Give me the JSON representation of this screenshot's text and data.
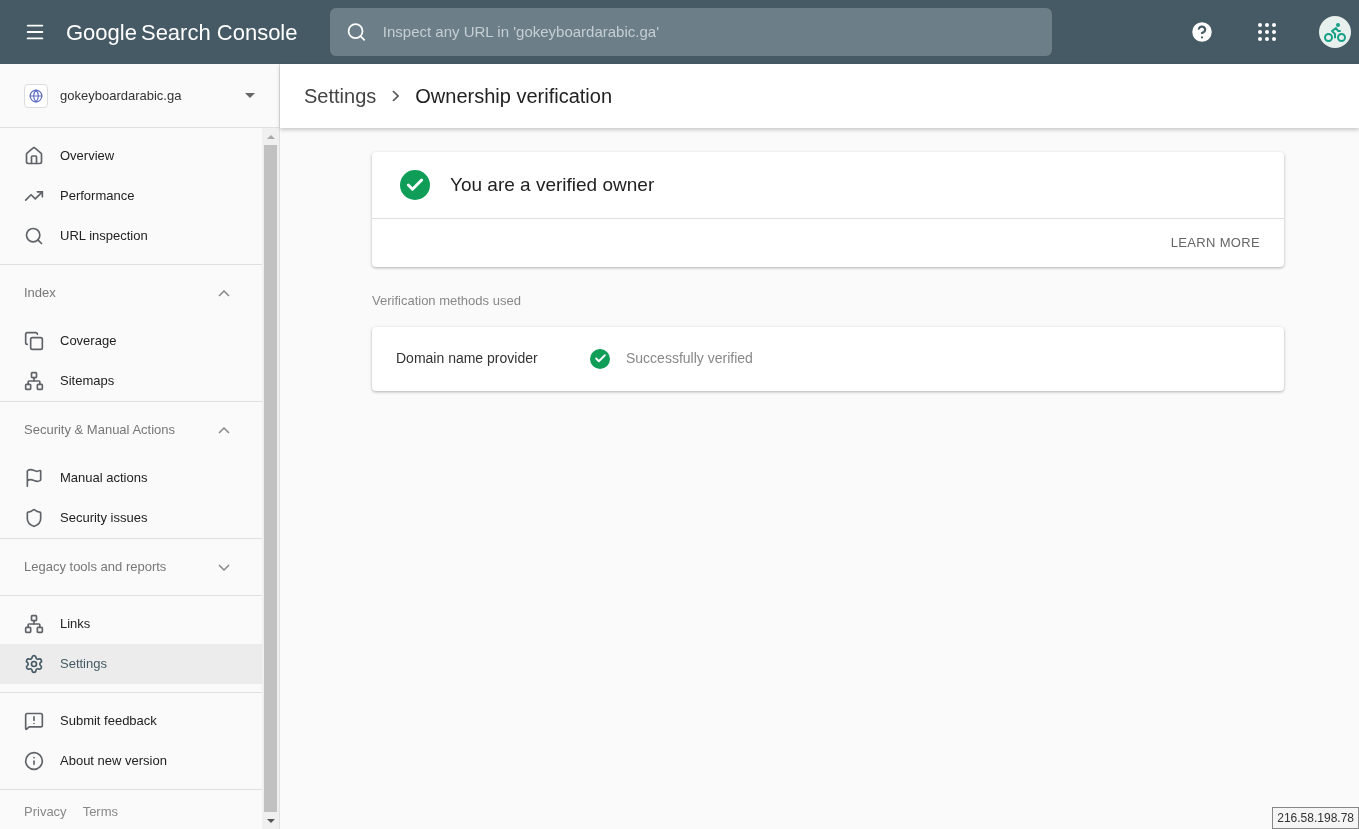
{
  "top_bar": {
    "title_logo": "Google",
    "title_product": "Search Console",
    "search": {
      "placeholder": "Inspect any URL in 'gokeyboardarabic.ga'"
    }
  },
  "property": {
    "name": "gokeyboardarabic.ga"
  },
  "sidebar": {
    "groups": [
      {
        "items": [
          {
            "label": "Overview",
            "selected": false
          },
          {
            "label": "Performance",
            "selected": false
          },
          {
            "label": "URL inspection",
            "selected": false
          }
        ]
      },
      {
        "header": "Index",
        "expanded": true,
        "items": [
          {
            "label": "Coverage",
            "selected": false
          },
          {
            "label": "Sitemaps",
            "selected": false
          }
        ]
      },
      {
        "header": "Security & Manual Actions",
        "expanded": true,
        "items": [
          {
            "label": "Manual actions",
            "selected": false
          },
          {
            "label": "Security issues",
            "selected": false
          }
        ]
      },
      {
        "header": "Legacy tools and reports",
        "expanded": false
      },
      {
        "items": [
          {
            "label": "Links",
            "selected": false
          },
          {
            "label": "Settings",
            "selected": true
          }
        ]
      },
      {
        "items": [
          {
            "label": "Submit feedback",
            "selected": false
          },
          {
            "label": "About new version",
            "selected": false
          }
        ]
      }
    ],
    "footer": [
      "Privacy",
      "Terms"
    ]
  },
  "breadcrumb": {
    "parent": "Settings",
    "current": "Ownership verification"
  },
  "owner_card": {
    "title": "You are a verified owner",
    "action": "LEARN MORE"
  },
  "methods": {
    "heading": "Verification methods used",
    "rows": [
      {
        "method": "Domain name provider",
        "status": "Successfully verified"
      }
    ]
  },
  "ip_tooltip": "216.58.198.78"
}
